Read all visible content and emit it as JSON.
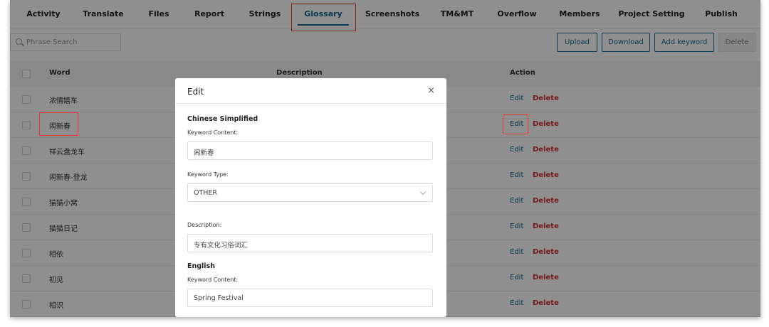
{
  "tabs": [
    {
      "label": "Activity"
    },
    {
      "label": "Translate"
    },
    {
      "label": "Files"
    },
    {
      "label": "Report"
    },
    {
      "label": "Strings"
    },
    {
      "label": "Glossary"
    },
    {
      "label": "Screenshots"
    },
    {
      "label": "TM&MT"
    },
    {
      "label": "Overflow"
    },
    {
      "label": "Members"
    },
    {
      "label": "Project Setting"
    },
    {
      "label": "Publish"
    }
  ],
  "active_tab": "Glossary",
  "search": {
    "placeholder": "Phrase Search"
  },
  "toolbar": {
    "upload_label": "Upload",
    "download_label": "Download",
    "add_keyword_label": "Add keyword",
    "delete_label": "Delete"
  },
  "table": {
    "headers": {
      "word": "Word",
      "description": "Description",
      "action": "Action"
    },
    "edit_label": "Edit",
    "delete_label": "Delete",
    "rows": [
      {
        "word": "浓情嬉车"
      },
      {
        "word": "闹新春"
      },
      {
        "word": "祥云盘龙车"
      },
      {
        "word": "闹新春-登龙"
      },
      {
        "word": "猫猫小窝"
      },
      {
        "word": "猫猫日记"
      },
      {
        "word": "相依"
      },
      {
        "word": "初见"
      },
      {
        "word": "相识"
      }
    ]
  },
  "modal": {
    "title": "Edit",
    "close_glyph": "×",
    "chinese_section": "Chinese Simplified",
    "keyword_content_label": "Keyword Content:",
    "keyword_content_value": "闹新春",
    "keyword_type_label": "Keyword Type:",
    "keyword_type_value": "OTHER",
    "description_label": "Description:",
    "description_value": "专有文化习俗词汇",
    "english_section": "English",
    "english_keyword_content_label": "Keyword Content:",
    "english_keyword_content_value": "Spring Festival"
  },
  "colors": {
    "accent": "#0f6a8f",
    "danger": "#d32f2f",
    "highlight": "#e53935"
  }
}
